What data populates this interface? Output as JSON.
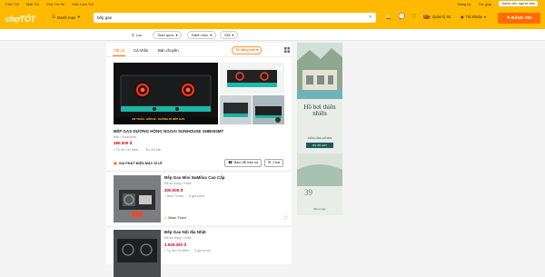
{
  "topbar": {
    "links": [
      "Chợ Tốt",
      "Nhà Tốt",
      "Chợ Tốt Xe",
      "Việc Làm Tốt"
    ],
    "right_links": [
      "Đăng ký",
      "Trợ giúp"
    ],
    "business_label": "Dành cho người bán"
  },
  "header": {
    "logo": "chợTỐT",
    "category_label": "Danh mục",
    "search_value": "bếp gas",
    "manage_label": "Quản lý tin",
    "account_label": "Tài khoản",
    "post_label": "ĐĂNG TIN"
  },
  "filters": {
    "filter_label": "Lọc",
    "chips": [
      "Toàn quốc",
      "Danh mục",
      "Giá"
    ]
  },
  "tabs": {
    "items": [
      "Tất cả",
      "Cá nhân",
      "Bán chuyên"
    ],
    "sort_label": "Tin đăng mới"
  },
  "featured": {
    "image_caption": "AN TOÀN · BỀN BỈ · KHÔNG RỈ BẾP GAS",
    "title": "BẾP GAS DƯƠNG HỒNG NGOẠI SUNHOUSE SHB004MT",
    "subtitle": "Mới • Sunhouse",
    "price": "380.000 đ",
    "location": "Tp Hồ Chí Minh",
    "time": "Tin nổi bật",
    "seller": "GIA PHÁT ĐIỆN MÁY SỈ LẺ",
    "call_label": "Bấm để hiện số",
    "chat_label": "Chat"
  },
  "items": [
    {
      "title": "Bếp Gas Mini NaMilux Cao Cấp",
      "subtitle": "Đã sử dụng • Khác",
      "price": "400.000 đ",
      "location": "Bình Thuận",
      "time": "8 giờ trước",
      "seller": "Nhan Thien"
    },
    {
      "title": "Bếp Gas Nội địa Nhật",
      "subtitle": "Đã sử dụng • Khác",
      "price": "2.000.000 đ",
      "location": "Tp Hồ Chí Minh",
      "time": "2 giờ trước",
      "seller": ""
    }
  ],
  "ad": {
    "headline": "Hồ bơi thiên nhiên",
    "small": "GIỮA LÒNG HỒ BƠI",
    "badge": "DỰ ÁN HOT",
    "price": "39",
    "foot": "Đầu tư ngay"
  },
  "colors": {
    "brand": "#ffba00",
    "accent": "#ff6b00",
    "price": "#d0021b"
  }
}
